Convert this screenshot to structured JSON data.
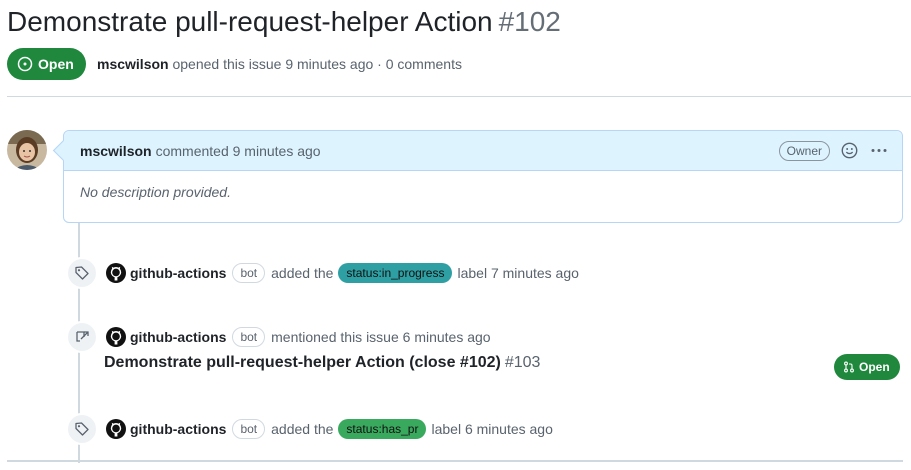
{
  "issue": {
    "title": "Demonstrate pull-request-helper Action",
    "number": "#102",
    "state_label": "Open",
    "author": "mscwilson",
    "meta_text": " opened this issue 9 minutes ago · 0 comments"
  },
  "comment": {
    "author": "mscwilson",
    "time_text": "commented 9 minutes ago",
    "role_badge": "Owner",
    "body": "No description provided."
  },
  "events": [
    {
      "icon": "tag-icon",
      "actor": "github-actions",
      "bot_badge": "bot",
      "prefix": "added the",
      "label": "status:in_progress",
      "label_color": "#2e9fa3",
      "suffix": "label 7 minutes ago"
    },
    {
      "icon": "cross-reference-icon",
      "actor": "github-actions",
      "bot_badge": "bot",
      "text": "mentioned this issue 6 minutes ago",
      "ref_title": "Demonstrate pull-request-helper Action (close #102)",
      "ref_number": "#103",
      "ref_state": "Open"
    },
    {
      "icon": "tag-icon",
      "actor": "github-actions",
      "bot_badge": "bot",
      "prefix": "added the",
      "label": "status:has_pr",
      "label_color": "#39a95e",
      "suffix": "label 6 minutes ago"
    }
  ],
  "colors": {
    "open_green": "#1f883d",
    "comment_header_bg": "#ddf4ff",
    "comment_border": "#b6d5f7"
  }
}
